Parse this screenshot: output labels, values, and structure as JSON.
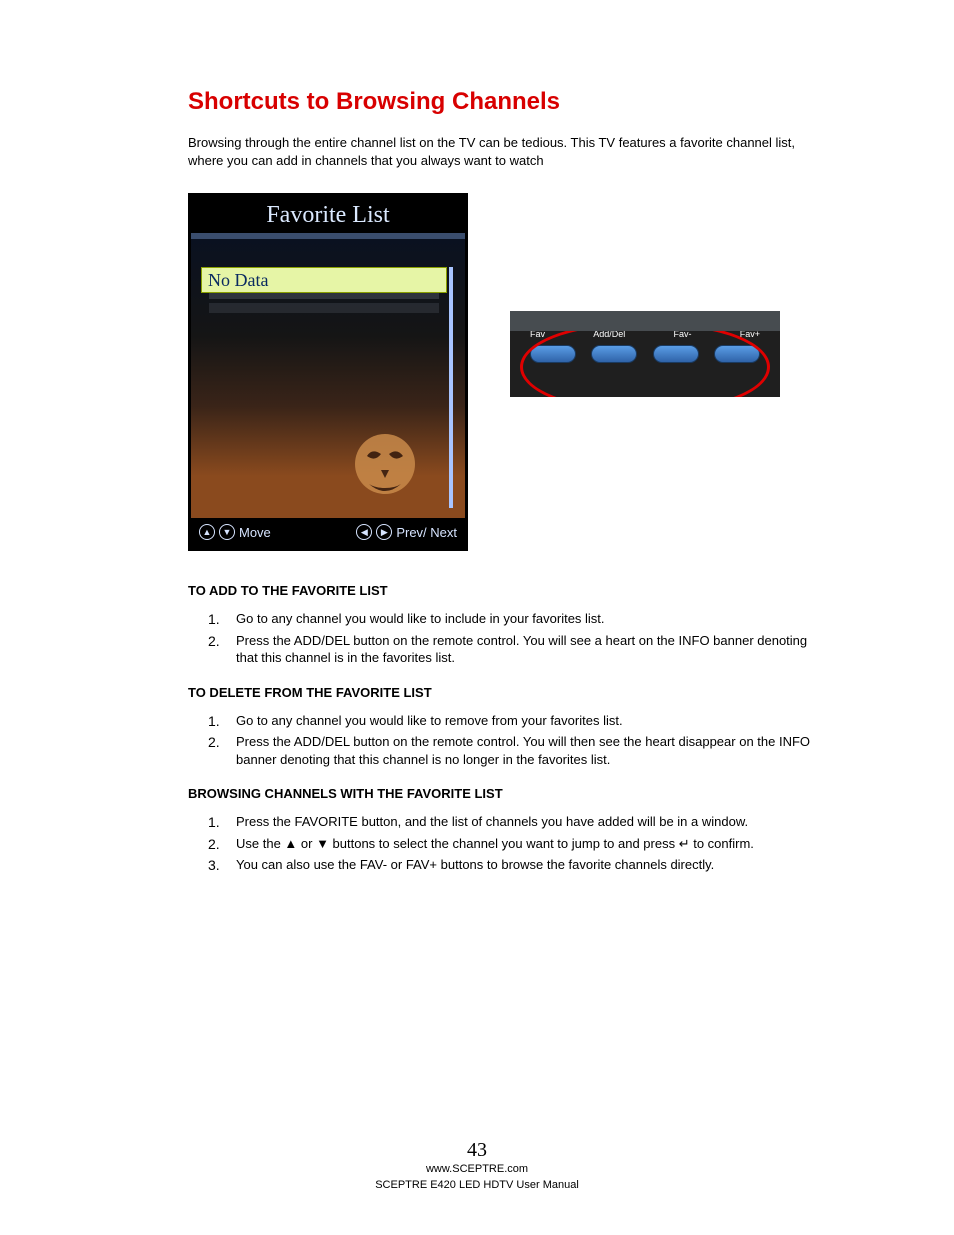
{
  "title": "Shortcuts to Browsing Channels",
  "intro": "Browsing through the entire channel list on the TV can be tedious.  This TV features a favorite channel list, where you can add in channels that you always want to watch",
  "tv": {
    "title": "Favorite List",
    "row": "No Data",
    "move": "Move",
    "prevnext": "Prev/ Next"
  },
  "remote": {
    "labels": [
      "Fav",
      "Add/Del",
      "Fav-",
      "Fav+"
    ]
  },
  "sections": {
    "add": {
      "head": "TO ADD TO THE FAVORITE LIST",
      "items": [
        "Go to any channel you would like to include in your favorites list.",
        "Press the ADD/DEL button on the remote control.  You will see a heart on the INFO banner denoting that this channel is in the favorites list."
      ]
    },
    "del": {
      "head": "TO DELETE FROM THE FAVORITE LIST",
      "items": [
        "Go to any channel you would like to remove from your favorites list.",
        "Press the ADD/DEL button on the remote control.  You will then see the heart disappear on the INFO banner denoting that this channel is no longer in the favorites list."
      ]
    },
    "browse": {
      "head": "BROWSING CHANNELS WITH THE FAVORITE LIST",
      "items": [
        "Press the FAVORITE button, and the list of channels you have added will be in a window.",
        "Use the ▲ or ▼ buttons to select the channel you want to jump to and press ↵ to confirm.",
        "You can also use the FAV- or FAV+ buttons to browse the favorite channels directly."
      ]
    }
  },
  "footer": {
    "page": "43",
    "url": "www.SCEPTRE.com",
    "manual": "SCEPTRE E420 LED HDTV User Manual"
  }
}
